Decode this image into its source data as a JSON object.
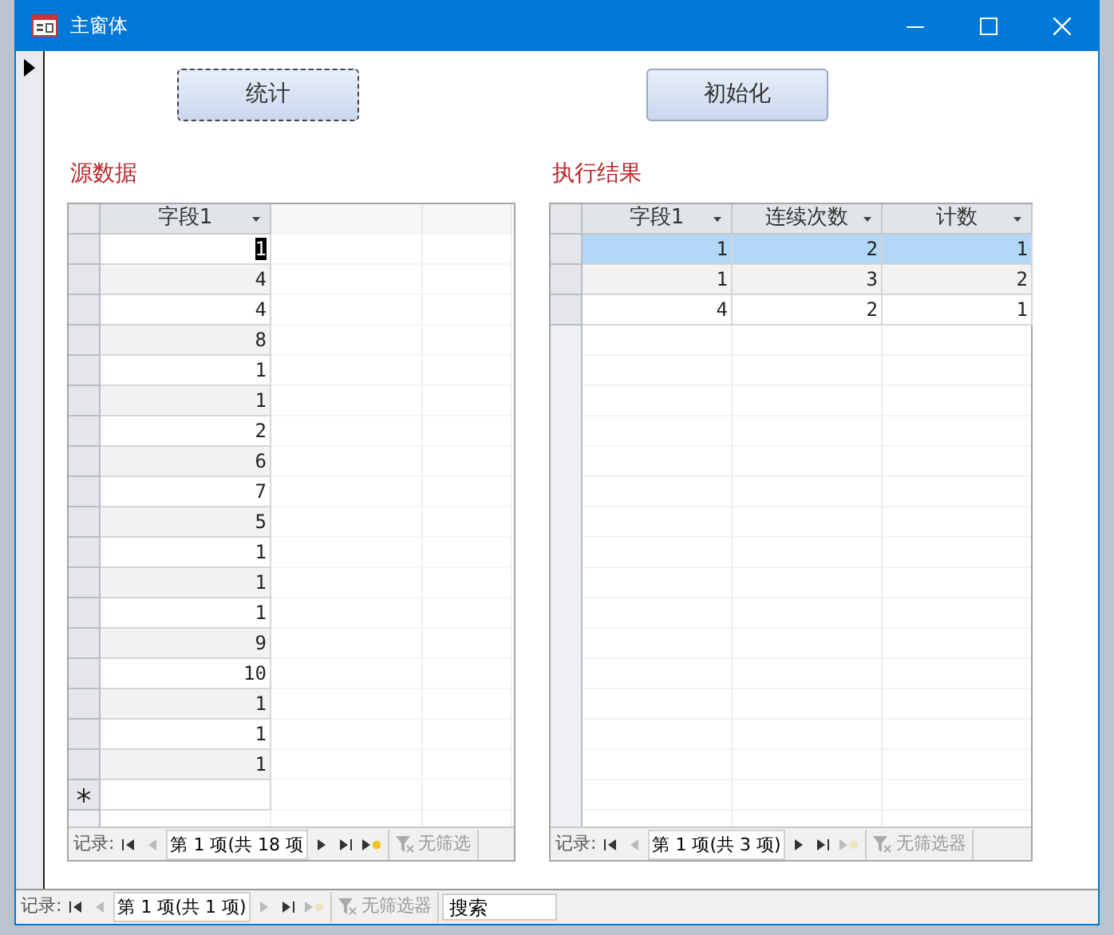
{
  "window": {
    "title": "主窗体"
  },
  "buttons": [
    {
      "label": "统计",
      "focused": true
    },
    {
      "label": "初始化",
      "focused": false
    }
  ],
  "grids": [
    {
      "title": "源数据",
      "columns": [
        {
          "label": "字段1"
        }
      ],
      "rows": [
        {
          "cells": [
            "1"
          ],
          "selected": false,
          "cell_focused": true
        },
        {
          "cells": [
            "4"
          ],
          "selected": false
        },
        {
          "cells": [
            "4"
          ],
          "selected": false
        },
        {
          "cells": [
            "8"
          ],
          "selected": false
        },
        {
          "cells": [
            "1"
          ],
          "selected": false
        },
        {
          "cells": [
            "1"
          ],
          "selected": false
        },
        {
          "cells": [
            "2"
          ],
          "selected": false
        },
        {
          "cells": [
            "6"
          ],
          "selected": false
        },
        {
          "cells": [
            "7"
          ],
          "selected": false
        },
        {
          "cells": [
            "5"
          ],
          "selected": false
        },
        {
          "cells": [
            "1"
          ],
          "selected": false
        },
        {
          "cells": [
            "1"
          ],
          "selected": false
        },
        {
          "cells": [
            "1"
          ],
          "selected": false
        },
        {
          "cells": [
            "9"
          ],
          "selected": false
        },
        {
          "cells": [
            "10"
          ],
          "selected": false
        },
        {
          "cells": [
            "1"
          ],
          "selected": false
        },
        {
          "cells": [
            "1"
          ],
          "selected": false
        },
        {
          "cells": [
            "1"
          ],
          "selected": false
        }
      ],
      "new_row": true,
      "navigator": {
        "label": "记录:",
        "position": "第 1 项(共 18 项",
        "first_disabled": false,
        "prev_disabled": true,
        "next_disabled": false,
        "last_disabled": false,
        "new_disabled": false,
        "filter": "无筛选"
      }
    },
    {
      "title": "执行结果",
      "columns": [
        {
          "label": "字段1"
        },
        {
          "label": "连续次数"
        },
        {
          "label": "计数"
        }
      ],
      "rows": [
        {
          "cells": [
            "1",
            "2",
            "1"
          ],
          "selected": true
        },
        {
          "cells": [
            "1",
            "3",
            "2"
          ],
          "selected": false
        },
        {
          "cells": [
            "4",
            "2",
            "1"
          ],
          "selected": false
        }
      ],
      "new_row": false,
      "navigator": {
        "label": "记录:",
        "position": "第 1 项(共 3 项)",
        "first_disabled": false,
        "prev_disabled": true,
        "next_disabled": false,
        "last_disabled": false,
        "new_disabled": true,
        "filter": "无筛选器"
      }
    }
  ],
  "form_navigator": {
    "label": "记录:",
    "position": "第 1 项(共 1 项)",
    "first_disabled": false,
    "prev_disabled": true,
    "next_disabled": true,
    "last_disabled": false,
    "new_disabled": true,
    "filter": "无筛选器",
    "search_placeholder": "搜索"
  }
}
